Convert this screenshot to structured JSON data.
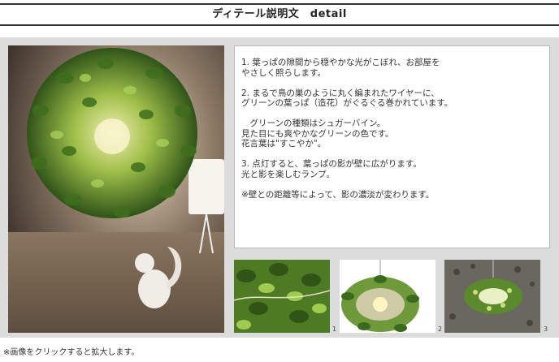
{
  "header": {
    "title": "ディテール説明文　detail"
  },
  "description": {
    "paragraphs": [
      "1. 葉っぱの隙間から穏やかな光がこぼれ、お部屋を\nやさしく照らします。",
      "2. まるで鳥の巣のように丸く編まれたワイヤーに、\nグリーンの葉っぱ（造花）がぐるぐる巻かれています。",
      "　グリーンの種類はシュガーバイン。\n見た目にも爽やかなグリーンの色です。\n花言葉は\"すこやか\"。",
      "3. 点灯すると、葉っぱの影が壁に広がります。\n光と影を楽しむランプ。",
      "※壁との距離等によって、影の濃淡が変わります。"
    ]
  },
  "thumbnails": [
    {
      "number": "1"
    },
    {
      "number": "2"
    },
    {
      "number": "3"
    }
  ],
  "footnote": "※画像をクリックすると拡大します。",
  "colors": {
    "panel_bg": "#dcdcdc",
    "leaf_green": "#5c8a2e",
    "warm_light": "#f5e9b0"
  }
}
